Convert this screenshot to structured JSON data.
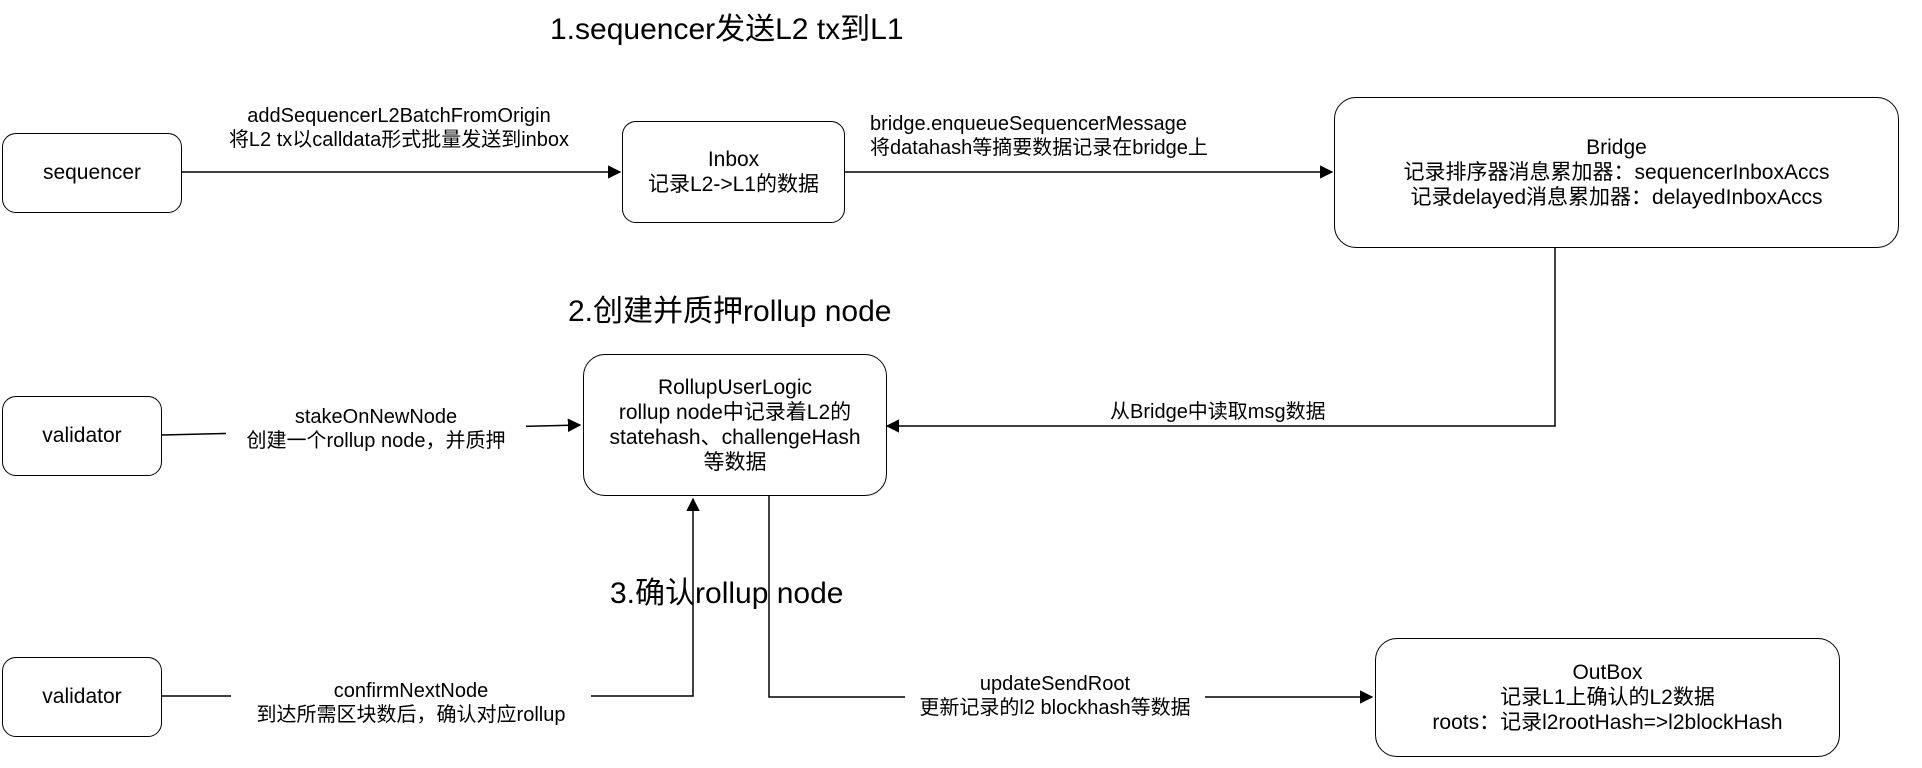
{
  "steps": {
    "s1": "1.sequencer发送L2 tx到L1",
    "s2": "2.创建并质押rollup node",
    "s3": "3.确认rollup node"
  },
  "nodes": {
    "sequencer": {
      "line1": "sequencer"
    },
    "inbox": {
      "line1": "Inbox",
      "line2": "记录L2->L1的数据"
    },
    "bridge": {
      "line1": "Bridge",
      "line2": "记录排序器消息累加器：sequencerInboxAccs",
      "line3": "记录delayed消息累加器：delayedInboxAccs"
    },
    "validator_top": {
      "line1": "validator"
    },
    "rollup": {
      "line1": "RollupUserLogic",
      "line2": "rollup node中记录着L2的",
      "line3": "statehash、challengeHash",
      "line4": "等数据"
    },
    "validator_bottom": {
      "line1": "validator"
    },
    "outbox": {
      "line1": "OutBox",
      "line2": "记录L1上确认的L2数据",
      "line3": "roots：记录l2rootHash=>l2blockHash"
    }
  },
  "edges": {
    "seq_inbox": {
      "line1": "addSequencerL2BatchFromOrigin",
      "line2": "将L2 tx以calldata形式批量发送到inbox"
    },
    "inbox_bridge": {
      "line1": "bridge.enqueueSequencerMessage",
      "line2": "将datahash等摘要数据记录在bridge上"
    },
    "bridge_rollup": {
      "line1": "从Bridge中读取msg数据"
    },
    "validator_rollup": {
      "line1": "stakeOnNewNode",
      "line2": "创建一个rollup node，并质押"
    },
    "validator_confirm": {
      "line1": "confirmNextNode",
      "line2": "到达所需区块数后，确认对应rollup"
    },
    "rollup_outbox": {
      "line1": "updateSendRoot",
      "line2": "更新记录的l2 blockhash等数据"
    }
  }
}
